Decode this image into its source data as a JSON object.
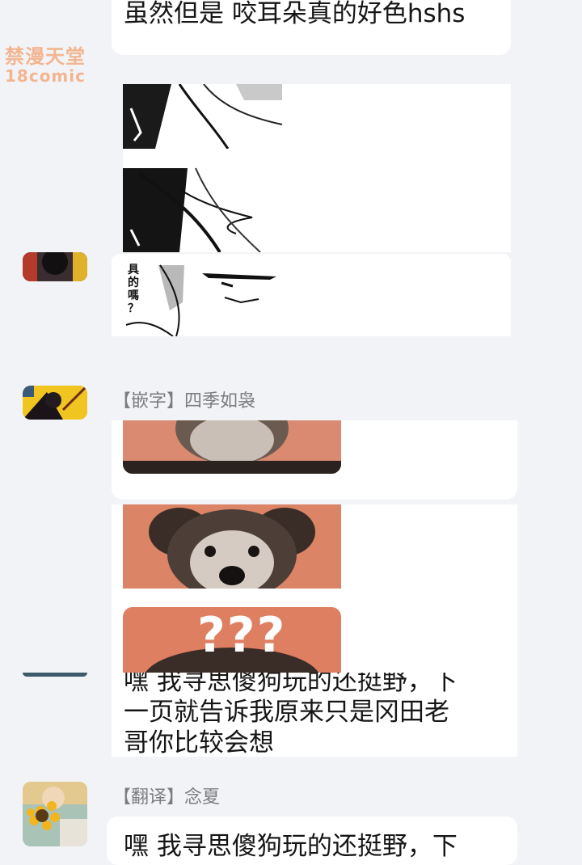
{
  "messages": {
    "first_text": "虽然但是 咬耳朵真的好色hshs",
    "last_text": "嘿 我寻思傻狗玩的还挺野，下\n一页就告诉我原来只是冈田老\n哥你比较会想",
    "bottom_partial_text": "嘿 我寻思傻狗玩的还挺野，下"
  },
  "watermark": {
    "line1": "禁漫天堂",
    "line2": "18comic"
  },
  "manga": {
    "vertical_text": "具\n的\n嗎\n？"
  },
  "senders": {
    "sender1": "【嵌字】四季如袅",
    "sender2": "【翻译】念夏"
  },
  "sticker": {
    "question_marks": "???"
  },
  "icons": [
    "avatar-image",
    "sunflower-avatar-image",
    "manga-panel-image",
    "dog-sticker-image"
  ]
}
